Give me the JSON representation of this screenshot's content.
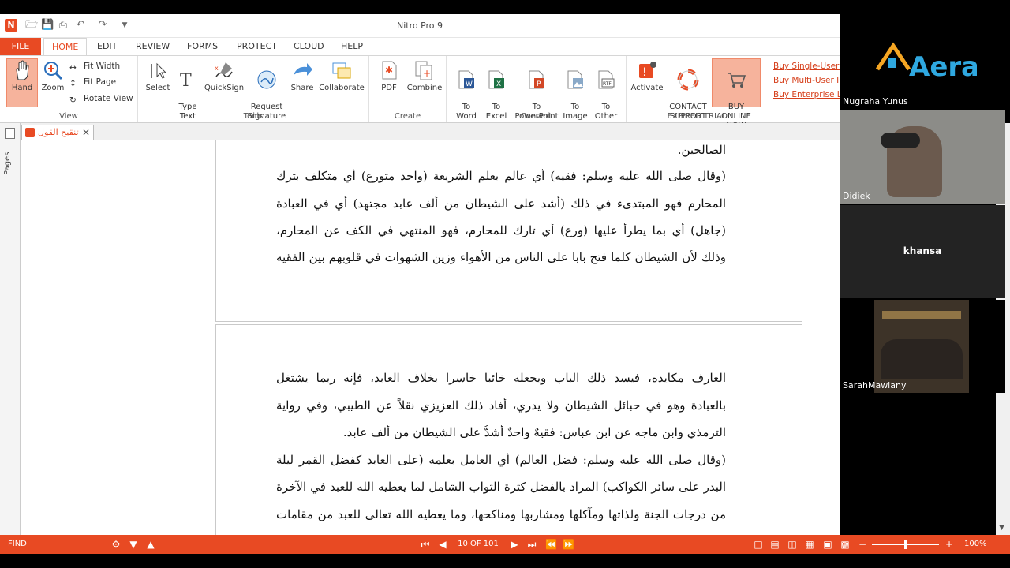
{
  "window": {
    "title": "Nitro Pro 9"
  },
  "ribbon_tabs": [
    "FILE",
    "HOME",
    "EDIT",
    "REVIEW",
    "FORMS",
    "PROTECT",
    "CLOUD",
    "HELP"
  ],
  "ribbon": {
    "view": {
      "label": "View",
      "hand": "Hand",
      "zoom": "Zoom",
      "fit_width": "Fit Width",
      "fit_page": "Fit Page",
      "rotate_view": "Rotate View"
    },
    "tools": {
      "label": "Tools",
      "select": "Select",
      "type_text": "Type\nText",
      "quicksign": "QuickSign",
      "request_signature": "Request\nSignature",
      "share": "Share",
      "collaborate": "Collaborate"
    },
    "create": {
      "label": "Create",
      "pdf": "PDF",
      "combine": "Combine"
    },
    "convert": {
      "label": "Convert",
      "to_word": "To\nWord",
      "to_excel": "To\nExcel",
      "to_powerpoint": "To\nPowerPoint",
      "to_image": "To\nImage",
      "to_other": "To\nOther"
    },
    "trial": {
      "label": "EXPIRED TRIAL",
      "activate": "Activate",
      "contact_support": "CONTACT\nSUPPORT",
      "buy_online": "BUY ONLINE\nNOW",
      "links": [
        "Buy Single-User Li",
        "Buy Multi-User Pa",
        "Buy Enterprise Lic"
      ]
    }
  },
  "document_tab": {
    "label": "تنقيح القول"
  },
  "side_panel": {
    "label": "Pages"
  },
  "page1_lines": [
    "الصالحين.",
    "(وقال صلى الله عليه وسلم: فقيه) أي عالم بعلم الشريعة (واحد متورع) أي متكلف بترك",
    "المحارم فهو المبتدىء في ذلك (أشد على الشيطان من ألف عابد مجتهد) أي في العبادة",
    "(جاهل) أي بما يطرأ عليها (ورع) أي تارك للمحارم، فهو المنتهي في الكف عن المحارم،",
    "وذلك لأن الشيطان كلما فتح بابا على الناس من الأهواء وزين الشهوات في قلوبهم بين الفقيه"
  ],
  "page2_lines": [
    "العارف مكايده، فيسد ذلك الباب ويجعله خائبا خاسرا بخلاف العابد، فإنه ربما يشتغل",
    "بالعبادة وهو في حبائل الشيطان ولا يدري، أفاد ذلك العزيزي نقلاً عن الطيبي، وفي رواية",
    "الترمذي وابن ماجه عن ابن عباس: فقيهٌ واحدٌ أشدُّ على الشيطان من ألف عابد.",
    "(وقال صلى الله عليه وسلم: فضل العالم) أي العامل بعلمه (على العابد كفضل القمر ليلة",
    "البدر على سائر الكواكب) المراد بالفضل كثرة الثواب الشامل لما يعطيه الله للعبد في الآخرة",
    "من درجات الجنة ولذاتها ومآكلها ومشاربها ومناكحها، وما يعطيه الله تعالى للعبد من مقامات"
  ],
  "status_bar": {
    "find": "FIND",
    "page_indicator": "10 OF 101",
    "zoom": "100%",
    "zoom_fraction": 0.48
  },
  "participants": [
    {
      "name": "Nugraha Yunus",
      "logo_text": "Aera"
    },
    {
      "name": "Didiek"
    },
    {
      "name": "khansa"
    },
    {
      "name": "SarahMawlany"
    }
  ],
  "colors": {
    "accent": "#e84a23",
    "trial_highlight": "#f6b39c"
  }
}
